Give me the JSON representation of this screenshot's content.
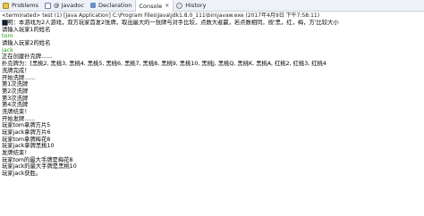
{
  "tabs": [
    {
      "label": "Problems",
      "icon": "problems-icon"
    },
    {
      "label": "@ Javadoc",
      "icon": "javadoc-icon"
    },
    {
      "label": "Declaration",
      "icon": "declaration-icon"
    },
    {
      "label": "Console",
      "icon": "console-icon",
      "close": "✕"
    },
    {
      "label": "History",
      "icon": "history-icon"
    }
  ],
  "console": {
    "header": "<terminated> test (1) [Java Application] C:\\Program Files\\Java\\jdk1.8.0_111\\bin\\javaw.exe (2017年4月9日 下午7:58:11)",
    "lines": [
      {
        "text": "说明：本游戏为2人游戏，双方玩家首发2张牌，取出最大的一张牌与对手比较，点数大者赢，若点数相同，按'黑，红，梅，方'比较大小",
        "color": "default"
      },
      {
        "text": "请输入玩家1的姓名",
        "color": "default"
      },
      {
        "text": "tom",
        "color": "green"
      },
      {
        "text": "请输入玩家2的姓名",
        "color": "default"
      },
      {
        "text": "jack",
        "color": "green"
      },
      {
        "text": "正在创建扑克牌......",
        "color": "default"
      },
      {
        "text": "扑克牌为：[黑桃2, 黑桃3, 黑桃4, 黑桃5, 黑桃6, 黑桃7, 黑桃8, 黑桃9, 黑桃10, 黑桃J, 黑桃Q, 黑桃K, 黑桃A, 红桃2, 红桃3, 红桃4",
        "color": "default"
      },
      {
        "text": "洗牌完成！",
        "color": "default"
      },
      {
        "text": "开始洗牌......",
        "color": "default"
      },
      {
        "text": "第1次洗牌",
        "color": "default"
      },
      {
        "text": "第2次洗牌",
        "color": "default"
      },
      {
        "text": "第3次洗牌",
        "color": "default"
      },
      {
        "text": "第4次洗牌",
        "color": "default"
      },
      {
        "text": "洗牌结束！",
        "color": "default"
      },
      {
        "text": "开始发牌......",
        "color": "default"
      },
      {
        "text": "玩家tom拿牌方片5",
        "color": "default"
      },
      {
        "text": "玩家jack拿牌方片6",
        "color": "default"
      },
      {
        "text": "玩家tom拿牌梅花8",
        "color": "default"
      },
      {
        "text": "玩家jack拿牌黑桃10",
        "color": "default"
      },
      {
        "text": "发牌结束！",
        "color": "default"
      },
      {
        "text": "玩家tom的最大手牌是梅花8",
        "color": "default"
      },
      {
        "text": "玩家jack的最大手牌是黑桃10",
        "color": "default"
      },
      {
        "text": "玩家jack获胜。",
        "color": "default"
      }
    ]
  },
  "colors": {
    "input_text": "#1a9a1a",
    "output_text": "#000000",
    "tabbar_bg": "#eef2f8"
  }
}
